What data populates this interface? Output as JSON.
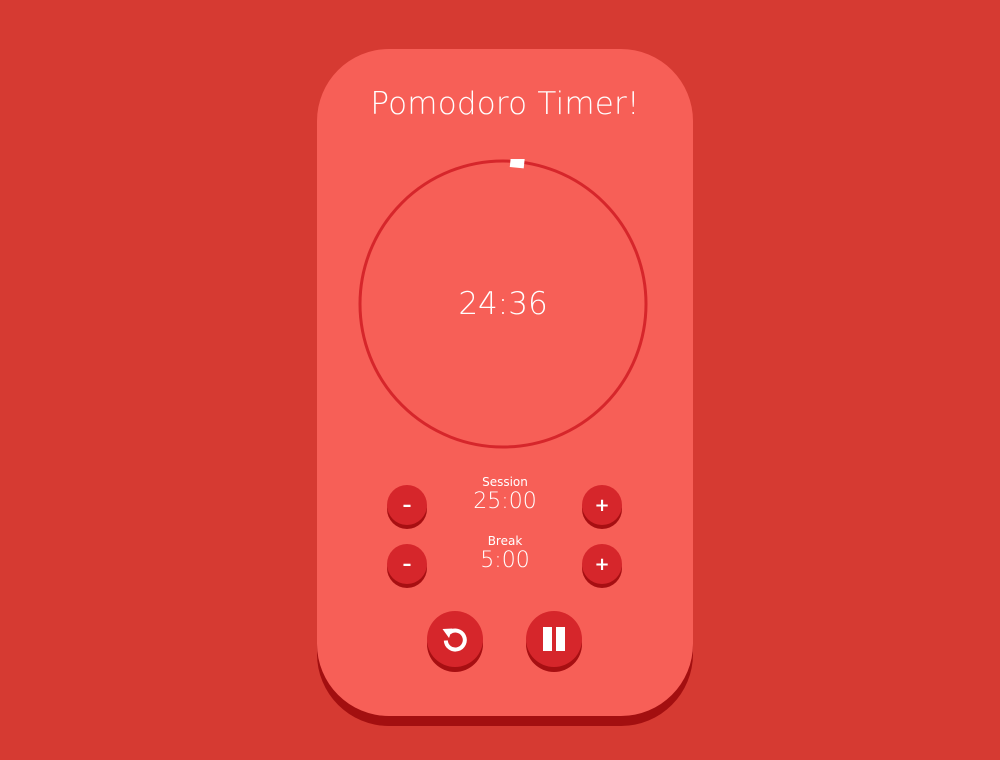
{
  "app": {
    "title": "Pomodoro Timer!"
  },
  "timer": {
    "display": "24:36",
    "progress_fraction": 0.016
  },
  "session": {
    "label": "Session",
    "value": "25:00",
    "decrement_label": "–",
    "increment_label": "+"
  },
  "break": {
    "label": "Break",
    "value": "5:00",
    "decrement_label": "–",
    "increment_label": "+"
  },
  "controls": {
    "reset_icon": "reset-icon",
    "pause_icon": "pause-icon"
  },
  "colors": {
    "background": "#d63a32",
    "card": "#f75f57",
    "card_shadow": "#a30f10",
    "button": "#d6262b",
    "button_shadow": "#a70f12",
    "ring": "#d6262b",
    "text": "#ffffff"
  }
}
